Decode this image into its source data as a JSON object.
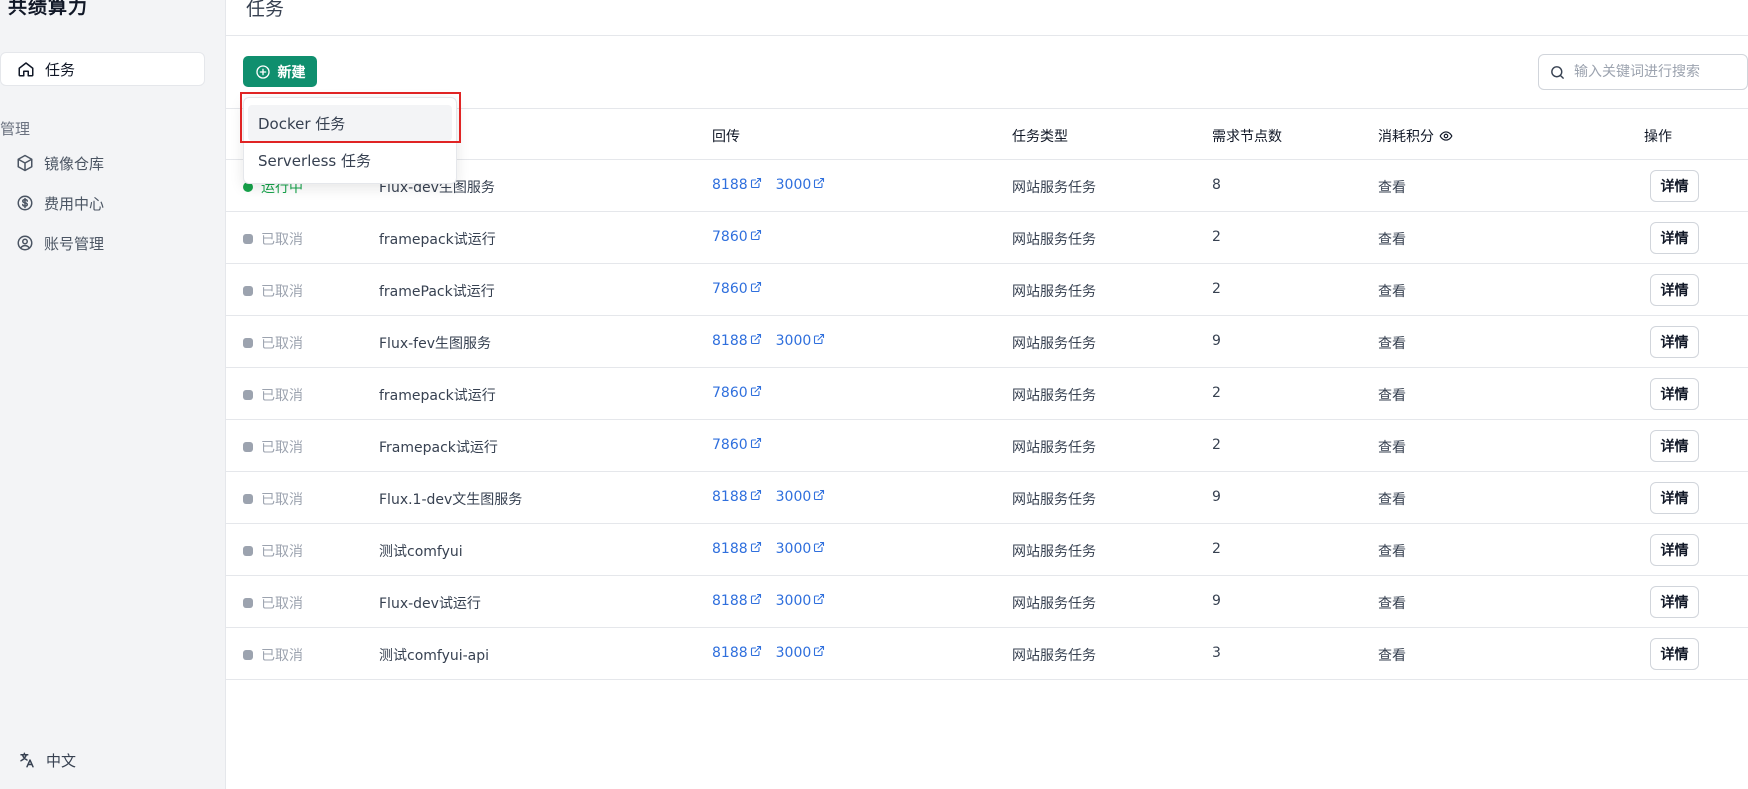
{
  "sidebar": {
    "brand": "共绩算力",
    "active_item": {
      "label": "任务",
      "icon": "home-icon"
    },
    "section_label": "管理",
    "items": [
      {
        "label": "镜像仓库",
        "icon": "cube-icon"
      },
      {
        "label": "费用中心",
        "icon": "dollar-icon"
      },
      {
        "label": "账号管理",
        "icon": "user-circle-icon"
      }
    ],
    "language": {
      "label": "中文",
      "icon": "translate-icon"
    }
  },
  "header": {
    "title": "任务"
  },
  "toolbar": {
    "new_label": "新建",
    "search_placeholder": "输入关键词进行搜索"
  },
  "dropdown": {
    "items": [
      "Docker 任务",
      "Serverless 任务"
    ]
  },
  "table": {
    "columns": {
      "ports": "回传",
      "type": "任务类型",
      "nodes": "需求节点数",
      "credits": "消耗积分",
      "actions": "操作"
    },
    "rows": [
      {
        "status": "运行中",
        "name": "Flux-dev生图服务",
        "ports": [
          "8188",
          "3000"
        ],
        "type": "网站服务任务",
        "nodes": "8",
        "credits": "查看",
        "action": "详情"
      },
      {
        "status": "已取消",
        "name": "framepack试运行",
        "ports": [
          "7860"
        ],
        "type": "网站服务任务",
        "nodes": "2",
        "credits": "查看",
        "action": "详情"
      },
      {
        "status": "已取消",
        "name": "framePack试运行",
        "ports": [
          "7860"
        ],
        "type": "网站服务任务",
        "nodes": "2",
        "credits": "查看",
        "action": "详情"
      },
      {
        "status": "已取消",
        "name": "Flux-fev生图服务",
        "ports": [
          "8188",
          "3000"
        ],
        "type": "网站服务任务",
        "nodes": "9",
        "credits": "查看",
        "action": "详情"
      },
      {
        "status": "已取消",
        "name": "framepack试运行",
        "ports": [
          "7860"
        ],
        "type": "网站服务任务",
        "nodes": "2",
        "credits": "查看",
        "action": "详情"
      },
      {
        "status": "已取消",
        "name": "Framepack试运行",
        "ports": [
          "7860"
        ],
        "type": "网站服务任务",
        "nodes": "2",
        "credits": "查看",
        "action": "详情"
      },
      {
        "status": "已取消",
        "name": "Flux.1-dev文生图服务",
        "ports": [
          "8188",
          "3000"
        ],
        "type": "网站服务任务",
        "nodes": "9",
        "credits": "查看",
        "action": "详情"
      },
      {
        "status": "已取消",
        "name": "测试comfyui",
        "ports": [
          "8188",
          "3000"
        ],
        "type": "网站服务任务",
        "nodes": "2",
        "credits": "查看",
        "action": "详情"
      },
      {
        "status": "已取消",
        "name": "Flux-dev试运行",
        "ports": [
          "8188",
          "3000"
        ],
        "type": "网站服务任务",
        "nodes": "9",
        "credits": "查看",
        "action": "详情"
      },
      {
        "status": "已取消",
        "name": "测试comfyui-api",
        "ports": [
          "8188",
          "3000"
        ],
        "type": "网站服务任务",
        "nodes": "3",
        "credits": "查看",
        "action": "详情"
      }
    ]
  },
  "colors": {
    "primary": "#0f8f6e",
    "link": "#2f6fdd",
    "running": "#16a34a",
    "cancelled": "#9ca3af",
    "highlight": "#e02424"
  }
}
